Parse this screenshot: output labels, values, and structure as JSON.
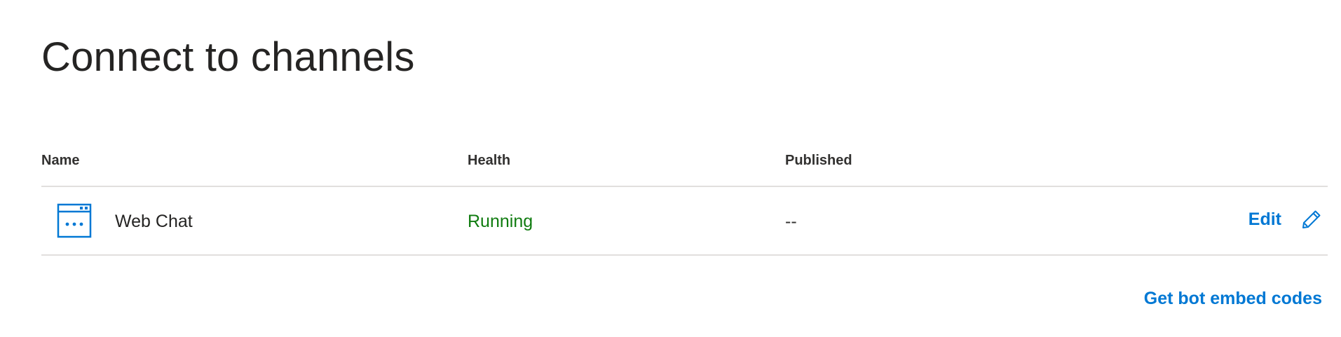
{
  "page": {
    "title": "Connect to channels"
  },
  "table": {
    "columns": {
      "name": "Name",
      "health": "Health",
      "published": "Published"
    },
    "rows": [
      {
        "icon": "web-chat-window-icon",
        "name": "Web Chat",
        "health": "Running",
        "published": "--",
        "action_label": "Edit",
        "action_icon": "pencil-edit-icon"
      }
    ]
  },
  "footer": {
    "embed_link": "Get bot embed codes"
  },
  "colors": {
    "accent": "#0078d4",
    "status_running": "#107c10",
    "divider": "#e1dfdd",
    "text": "#323130"
  }
}
